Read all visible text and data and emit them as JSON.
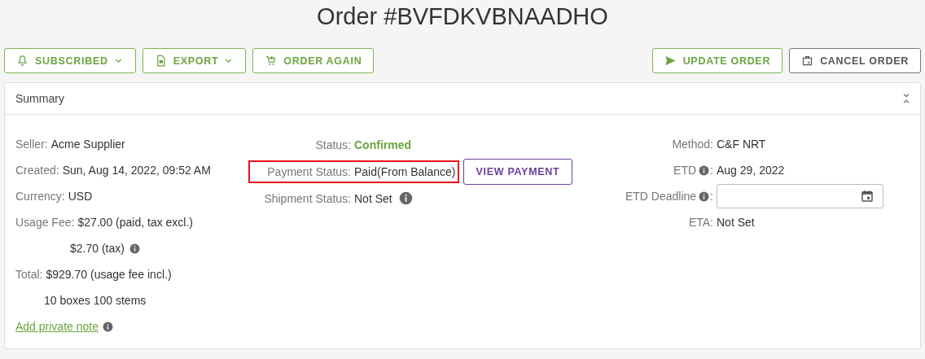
{
  "title": "Order #BVFDKVBNAADHO",
  "toolbar_left": [
    {
      "label": "SUBSCRIBED",
      "caret": true,
      "kind": "primary"
    },
    {
      "label": "EXPORT",
      "caret": true,
      "kind": "primary"
    },
    {
      "label": "ORDER AGAIN",
      "caret": false,
      "kind": "primary"
    }
  ],
  "toolbar_right": [
    {
      "label": "UPDATE ORDER",
      "caret": false,
      "kind": "primary"
    },
    {
      "label": "CANCEL ORDER",
      "caret": false,
      "kind": "neutral"
    }
  ],
  "summary": {
    "title": "Summary",
    "expanded": true,
    "left": [
      {
        "kind": "field",
        "label": "Seller:",
        "value": "Acme Supplier"
      },
      {
        "kind": "field",
        "label": "Created:",
        "value": "Sun, Aug 14, 2022, 09:52 AM"
      },
      {
        "kind": "field",
        "label": "Currency:",
        "value": "USD"
      },
      {
        "kind": "field",
        "label": "Usage Fee:",
        "value": "$27.00 (paid, tax excl.)"
      },
      {
        "kind": "tax",
        "value": "$2.70 (tax)",
        "info": true
      },
      {
        "kind": "field",
        "label": "Total:",
        "value": "$929.70 (usage fee incl.)"
      },
      {
        "kind": "count",
        "value": "10 boxes 100 stems"
      },
      {
        "kind": "link",
        "value": "Add private note",
        "info": true
      }
    ],
    "middle": [
      {
        "kind": "status",
        "label": "Status:",
        "value": "Confirmed",
        "highlighted": false
      },
      {
        "kind": "field",
        "label": "Payment Status:",
        "value": "Paid(From Balance)",
        "highlighted": true,
        "button": "VIEW PAYMENT"
      },
      {
        "kind": "field",
        "label": "Shipment Status:",
        "value": "Not Set",
        "info": true,
        "highlighted": false
      }
    ],
    "right": [
      {
        "kind": "field",
        "label": "Method:",
        "value": "C&F NRT"
      },
      {
        "kind": "field",
        "label": "ETD",
        "label_info": true,
        "separator": ":",
        "value": "Aug 29, 2022"
      },
      {
        "kind": "date-input",
        "label": "ETD Deadline",
        "label_info": true,
        "separator": ":"
      },
      {
        "kind": "field",
        "label": "ETA:",
        "value": "Not Set"
      }
    ]
  }
}
